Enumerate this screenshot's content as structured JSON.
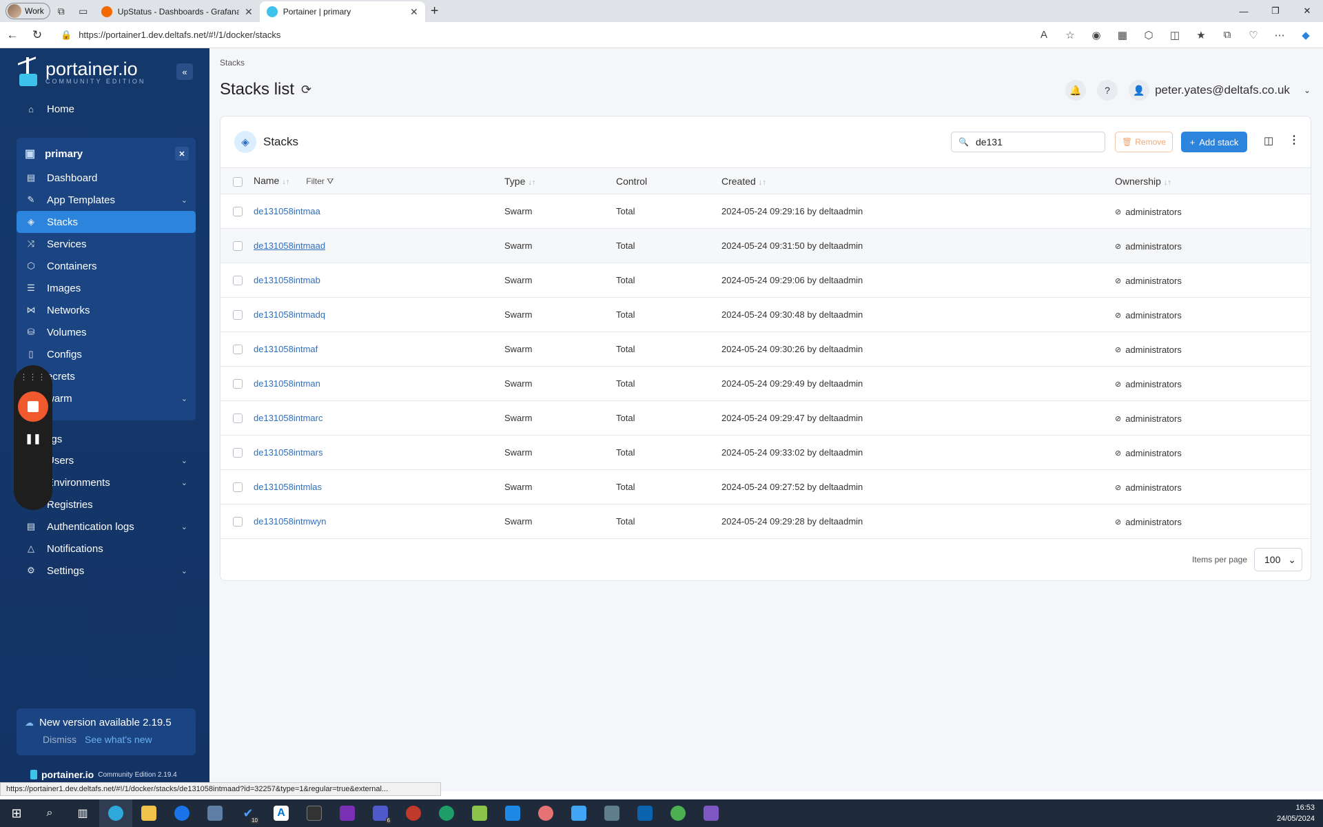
{
  "browser": {
    "profile": "Work",
    "tabs": [
      {
        "title": "UpStatus - Dashboards - Grafana",
        "color": "#f46800"
      },
      {
        "title": "Portainer | primary",
        "color": "#3dc2eb"
      }
    ],
    "url": "https://portainer1.dev.deltafs.net/#!/1/docker/stacks",
    "status_url": "https://portainer1.dev.deltafs.net/#!/1/docker/stacks/de131058intmaad?id=32257&type=1&regular=true&external..."
  },
  "sidebar": {
    "logo": "portainer.io",
    "logo_sub": "COMMUNITY EDITION",
    "home": "Home",
    "env_name": "primary",
    "env_items": [
      {
        "label": "Dashboard",
        "icon": "dashboard-icon"
      },
      {
        "label": "App Templates",
        "icon": "edit-icon",
        "chev": true
      },
      {
        "label": "Stacks",
        "icon": "layers-icon",
        "active": true
      },
      {
        "label": "Services",
        "icon": "shuffle-icon"
      },
      {
        "label": "Containers",
        "icon": "box-icon"
      },
      {
        "label": "Images",
        "icon": "list-icon"
      },
      {
        "label": "Networks",
        "icon": "network-icon"
      },
      {
        "label": "Volumes",
        "icon": "database-icon"
      },
      {
        "label": "Configs",
        "icon": "file-icon"
      },
      {
        "label": "ecrets",
        "icon": "lock-icon"
      },
      {
        "label": "warm",
        "icon": "swarm-icon",
        "chev": true
      }
    ],
    "settings_title": "Settings",
    "settings_items": [
      {
        "label": "Users",
        "icon": "user-icon",
        "chev": true
      },
      {
        "label": "Environments",
        "icon": "hdd-icon",
        "chev": true
      },
      {
        "label": "Registries",
        "icon": "radio-icon"
      },
      {
        "label": "Authentication logs",
        "icon": "file-text-icon",
        "chev": true
      },
      {
        "label": "Notifications",
        "icon": "bell-icon"
      },
      {
        "label": "Settings",
        "icon": "gear-icon",
        "chev": true
      }
    ],
    "update_title": "New version available 2.19.5",
    "dismiss": "Dismiss",
    "whats_new": "See what's new",
    "footer_brand": "portainer.io",
    "footer_edition": "Community Edition 2.19.4"
  },
  "main": {
    "breadcrumb": "Stacks",
    "title": "Stacks list",
    "user": "peter.yates@deltafs.co.uk",
    "card_title": "Stacks",
    "search_value": "de131",
    "remove_label": "Remove",
    "add_label": "Add stack",
    "columns": {
      "name": "Name",
      "filter": "Filter",
      "type": "Type",
      "control": "Control",
      "created": "Created",
      "ownership": "Ownership"
    },
    "rows": [
      {
        "name": "de131058intmaa",
        "type": "Swarm",
        "control": "Total",
        "created": "2024-05-24 09:29:16 by deltaadmin",
        "ownership": "administrators"
      },
      {
        "name": "de131058intmaad",
        "type": "Swarm",
        "control": "Total",
        "created": "2024-05-24 09:31:50 by deltaadmin",
        "ownership": "administrators"
      },
      {
        "name": "de131058intmab",
        "type": "Swarm",
        "control": "Total",
        "created": "2024-05-24 09:29:06 by deltaadmin",
        "ownership": "administrators"
      },
      {
        "name": "de131058intmadq",
        "type": "Swarm",
        "control": "Total",
        "created": "2024-05-24 09:30:48 by deltaadmin",
        "ownership": "administrators"
      },
      {
        "name": "de131058intmaf",
        "type": "Swarm",
        "control": "Total",
        "created": "2024-05-24 09:30:26 by deltaadmin",
        "ownership": "administrators"
      },
      {
        "name": "de131058intman",
        "type": "Swarm",
        "control": "Total",
        "created": "2024-05-24 09:29:49 by deltaadmin",
        "ownership": "administrators"
      },
      {
        "name": "de131058intmarc",
        "type": "Swarm",
        "control": "Total",
        "created": "2024-05-24 09:29:47 by deltaadmin",
        "ownership": "administrators"
      },
      {
        "name": "de131058intmars",
        "type": "Swarm",
        "control": "Total",
        "created": "2024-05-24 09:33:02 by deltaadmin",
        "ownership": "administrators"
      },
      {
        "name": "de131058intmlas",
        "type": "Swarm",
        "control": "Total",
        "created": "2024-05-24 09:27:52 by deltaadmin",
        "ownership": "administrators"
      },
      {
        "name": "de131058intmwyn",
        "type": "Swarm",
        "control": "Total",
        "created": "2024-05-24 09:29:28 by deltaadmin",
        "ownership": "administrators"
      }
    ],
    "items_per_page_label": "Items per page",
    "items_per_page": "100"
  },
  "taskbar": {
    "time": "16:53",
    "date": "24/05/2024",
    "badges": {
      "todo": "10",
      "teams": "6"
    }
  }
}
